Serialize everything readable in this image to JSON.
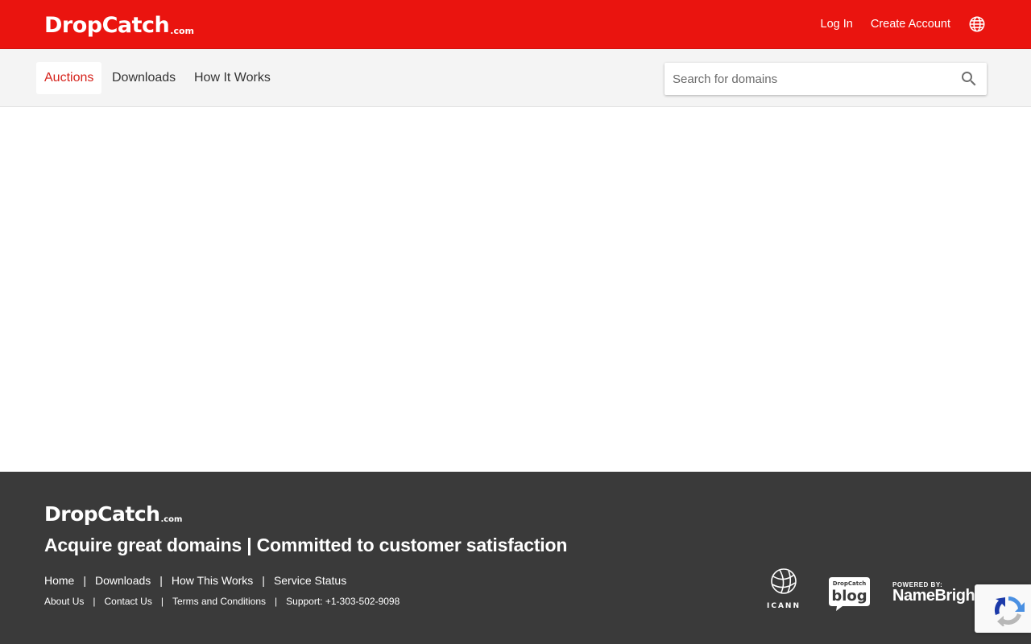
{
  "header": {
    "logo_word": "DropCatch",
    "logo_suffix": ".com",
    "login": "Log In",
    "create_account": "Create Account",
    "language_icon": "globe-icon"
  },
  "nav": {
    "tabs": [
      {
        "label": "Auctions",
        "active": true
      },
      {
        "label": "Downloads",
        "active": false
      },
      {
        "label": "How It Works",
        "active": false
      }
    ]
  },
  "search": {
    "placeholder": "Search for domains",
    "value": "",
    "icon": "search-icon"
  },
  "footer": {
    "logo_word": "DropCatch",
    "logo_suffix": ".com",
    "tagline": "Acquire great domains | Committed to customer satisfaction",
    "primary_links": [
      "Home",
      "Downloads",
      "How This Works",
      "Service Status"
    ],
    "secondary_links": [
      "About Us",
      "Contact Us",
      "Terms and Conditions",
      "Support: +1-303-502-9098"
    ],
    "badges": {
      "icann": "ICANN",
      "blog_top": "DropCatch",
      "blog_word": "blog",
      "powered_by": "POWERED BY:",
      "namebright": "NameBright.c"
    }
  },
  "colors": {
    "brand_red": "#ea140f",
    "active_tab_text": "#d6231c",
    "footer_bg": "#3a3a3a",
    "subnav_bg": "#f4f4f4"
  }
}
